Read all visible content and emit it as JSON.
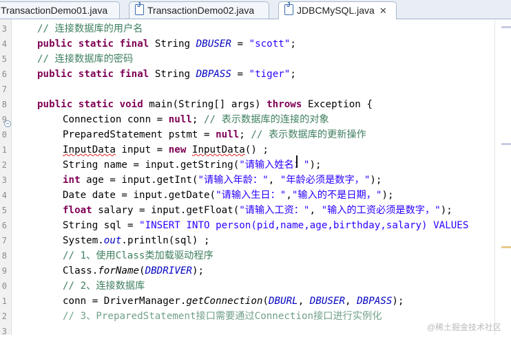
{
  "tabs": [
    {
      "label": "TransactionDemo01.java",
      "active": false
    },
    {
      "label": "TransactionDemo02.java",
      "active": false
    },
    {
      "label": "JDBCMySQL.java",
      "active": true,
      "close": "✕"
    }
  ],
  "line_numbers": [
    "3",
    "4",
    "5",
    "6",
    "7",
    "8",
    "9",
    "0",
    "1",
    "2",
    "3",
    "4",
    "5",
    "6",
    "7",
    "8",
    "9",
    "0",
    "1",
    "2",
    "3"
  ],
  "code": {
    "l1": {
      "comment": "// 连接数据库的用户名"
    },
    "l2": {
      "kw1": "public static final",
      "type": "String",
      "name": "DBUSER",
      "op": "=",
      "str": "\"scott\"",
      "end": ";"
    },
    "l3": {
      "comment": "// 连接数据库的密码"
    },
    "l4": {
      "kw1": "public static final",
      "type": "String",
      "name": "DBPASS",
      "op": "=",
      "str": "\"tiger\"",
      "end": ";"
    },
    "l6": {
      "kw1": "public static void",
      "sig": "main(String[] args)",
      "kw2": "throws",
      "rest": "Exception {"
    },
    "l7": {
      "pre": "Connection conn = ",
      "kw": "null",
      "mid": "; ",
      "comment": "// 表示数据库的连接的对象"
    },
    "l8": {
      "pre": "PreparedStatement pstmt = ",
      "kw": "null",
      "mid": "; ",
      "comment": "// 表示数据库的更新操作"
    },
    "l9": {
      "t1": "InputData",
      "mid": " input = ",
      "kw": "new",
      "t2": "InputData",
      "end": "() ;"
    },
    "l10": {
      "pre": "String name = input.getString(",
      "s1": "\"请输入姓名：\"",
      "end": ");"
    },
    "l11": {
      "kw": "int",
      "pre": " age = input.getInt(",
      "s1": "\"请输入年龄：\"",
      "sep": ", ",
      "s2": "\"年龄必须是数字，\"",
      "end": ");"
    },
    "l12": {
      "pre": "Date date = input.getDate(",
      "s1": "\"请输入生日：\"",
      "sep": ",",
      "s2": "\"输入的不是日期，\"",
      "end": ");"
    },
    "l13": {
      "kw": "float",
      "pre": " salary = input.getFloat(",
      "s1": "\"请输入工资：\"",
      "sep": ", ",
      "s2": "\"输入的工资必须是数字，\"",
      "end": ");"
    },
    "l14": {
      "pre": "String sql = ",
      "str": "\"INSERT INTO person(pid,name,age,birthday,salary) VALUES"
    },
    "l15": {
      "pre": "System.",
      "field": "out",
      "rest": ".println(sql) ;"
    },
    "l16": {
      "comment": "// 1、使用Class类加载驱动程序"
    },
    "l17": {
      "pre": "Class.",
      "method": "forName",
      "open": "(",
      "arg": "DBDRIVER",
      "end": ");"
    },
    "l18": {
      "comment": "// 2、连接数据库"
    },
    "l19": {
      "pre": "conn = DriverManager.",
      "method": "getConnection",
      "open": "(",
      "a1": "DBURL",
      "c1": ", ",
      "a2": "DBUSER",
      "c2": ", ",
      "a3": "DBPASS",
      "end": ");"
    },
    "l20": {
      "comment": "// 3、PreparedStatement接口需要通过Connection接口进行实例化"
    }
  },
  "watermark": "@稀土掘金技术社区"
}
